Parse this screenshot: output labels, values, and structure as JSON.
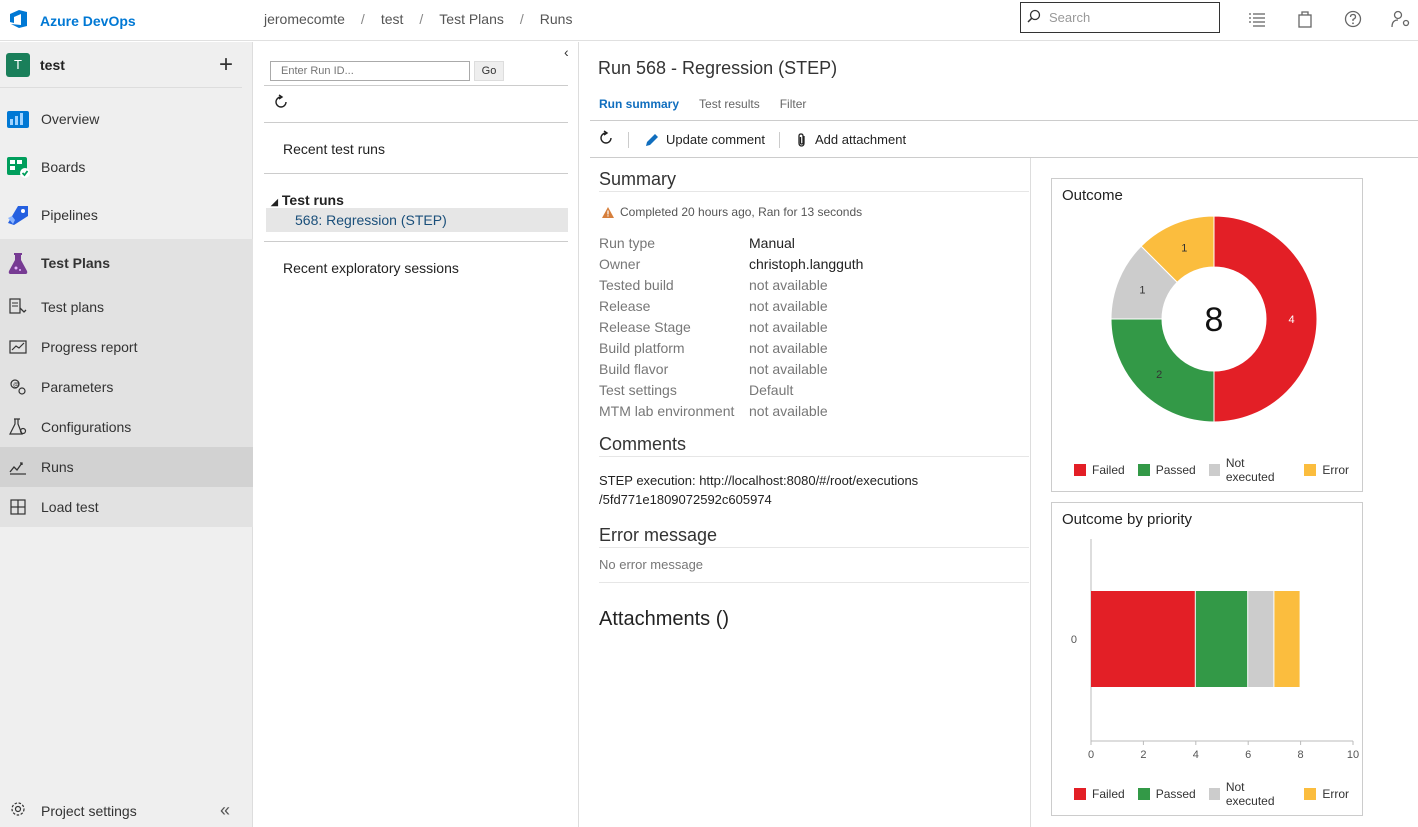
{
  "header": {
    "brand": "Azure DevOps",
    "breadcrumbs": [
      "jeromecomte",
      "test",
      "Test Plans",
      "Runs"
    ],
    "search_placeholder": "Search",
    "icons": [
      "list-icon",
      "shopping-bag-icon",
      "help-icon",
      "user-settings-icon"
    ]
  },
  "sidebar": {
    "project_initial": "T",
    "project_name": "test",
    "items": [
      {
        "label": "Overview",
        "icon": "overview-icon"
      },
      {
        "label": "Boards",
        "icon": "boards-icon"
      },
      {
        "label": "Pipelines",
        "icon": "pipelines-icon"
      },
      {
        "label": "Test Plans",
        "icon": "test-plans-icon"
      },
      {
        "label": "Test plans",
        "icon": "test-plans-list-icon"
      },
      {
        "label": "Progress report",
        "icon": "progress-report-icon"
      },
      {
        "label": "Parameters",
        "icon": "parameters-icon"
      },
      {
        "label": "Configurations",
        "icon": "configurations-icon"
      },
      {
        "label": "Runs",
        "icon": "runs-icon"
      },
      {
        "label": "Load test",
        "icon": "load-test-icon"
      }
    ],
    "footer_label": "Project settings"
  },
  "runs_panel": {
    "run_id_placeholder": "Enter Run ID...",
    "go_label": "Go",
    "recent_runs": "Recent test runs",
    "tree_header": "Test runs",
    "tree_item": "568: Regression (STEP)",
    "recent_sessions": "Recent exploratory sessions"
  },
  "run": {
    "title": "Run 568 - Regression (STEP)",
    "tabs": [
      "Run summary",
      "Test results",
      "Filter"
    ],
    "toolbar": {
      "update_comment": "Update comment",
      "add_attachment": "Add attachment"
    },
    "summary_title": "Summary",
    "status": "Completed 20 hours ago, Ran for 13 seconds",
    "properties": [
      {
        "key": "Run type",
        "value": "Manual"
      },
      {
        "key": "Owner",
        "value": "christoph.langguth"
      },
      {
        "key": "Tested build",
        "value": "not available"
      },
      {
        "key": "Release",
        "value": "not available"
      },
      {
        "key": "Release Stage",
        "value": "not available"
      },
      {
        "key": "Build platform",
        "value": "not available"
      },
      {
        "key": "Build flavor",
        "value": "not available"
      },
      {
        "key": "Test settings",
        "value": "Default"
      },
      {
        "key": "MTM lab environment",
        "value": "not available"
      }
    ],
    "comments_title": "Comments",
    "comment_line1": "STEP execution: http://localhost:8080/#/root/executions",
    "comment_line2": "/5fd771e1809072592c605974",
    "error_title": "Error message",
    "error_text": "No error message",
    "attachments_title": "Attachments ()"
  },
  "chart_data": [
    {
      "type": "pie",
      "title": "Outcome",
      "center_label": "8",
      "categories": [
        "Failed",
        "Passed",
        "Not executed",
        "Error"
      ],
      "values": [
        4,
        2,
        1,
        1
      ],
      "colors": [
        "#e31f26",
        "#339947",
        "#cccccc",
        "#fbbd3e"
      ]
    },
    {
      "type": "bar",
      "title": "Outcome by priority",
      "orientation": "horizontal",
      "stacked": true,
      "categories": [
        "0"
      ],
      "series": [
        {
          "name": "Failed",
          "values": [
            4
          ]
        },
        {
          "name": "Passed",
          "values": [
            2
          ]
        },
        {
          "name": "Not executed",
          "values": [
            1
          ]
        },
        {
          "name": "Error",
          "values": [
            1
          ]
        }
      ],
      "colors": [
        "#e31f26",
        "#339947",
        "#cccccc",
        "#fbbd3e"
      ],
      "x_ticks": [
        "0",
        "2",
        "4",
        "6",
        "8",
        "10"
      ],
      "xlim": [
        0,
        10
      ]
    }
  ]
}
